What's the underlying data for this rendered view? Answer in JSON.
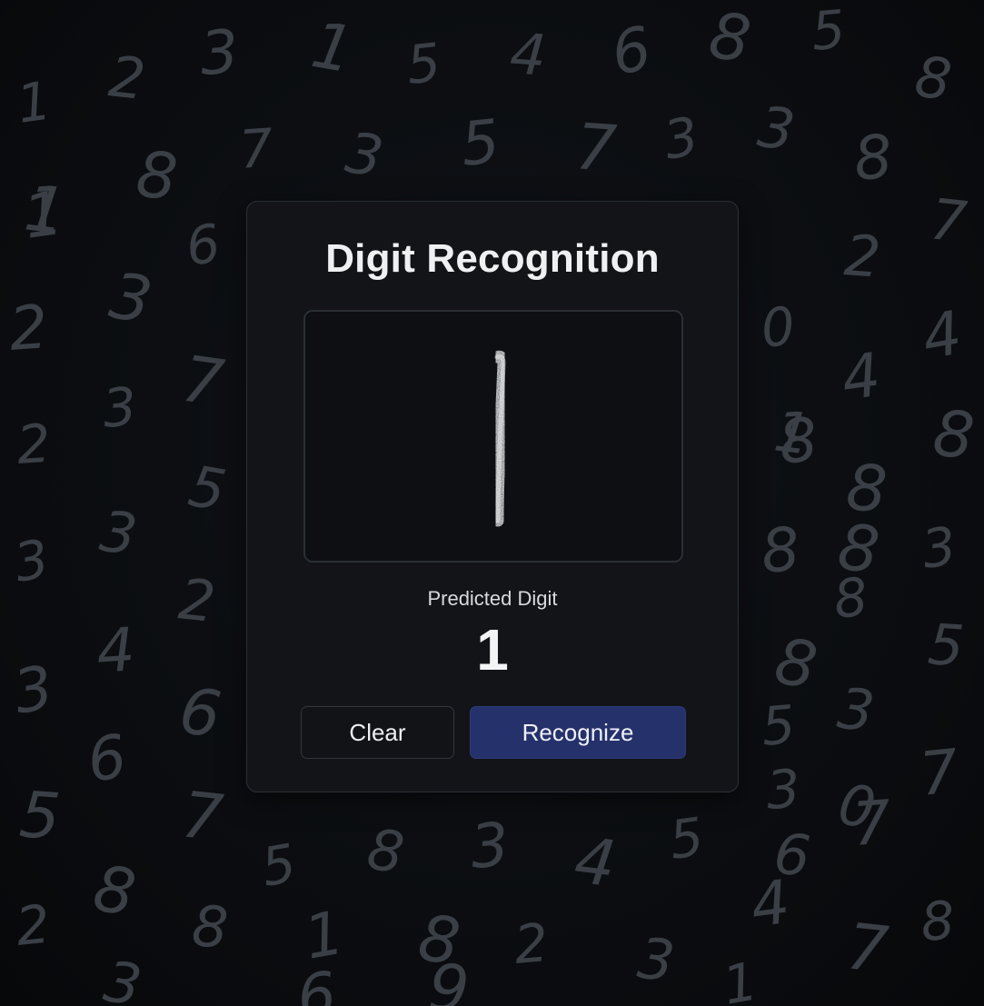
{
  "app": {
    "title": "Digit Recognition"
  },
  "canvas": {
    "drawn_digit": "1"
  },
  "prediction": {
    "label": "Predicted Digit",
    "value": "1"
  },
  "buttons": {
    "clear_label": "Clear",
    "recognize_label": "Recognize"
  },
  "colors": {
    "background": "#0b0d10",
    "card": "#121418",
    "primary_button": "#25316a",
    "handwriting": "#3a3f45"
  },
  "background_digits": "1 2 3 1 5 4 6 8 5 8 1 8 7 3 5 7 3 3 8 1 6 7 2 3 0 2 4 7 3 1 4 8 2 5 8 8 3 3 8 8 3 2 4 8 8 5 3 6 5 3 6 7 3 0 7 5 5 8 3 4 5 6 7 8 2 8 1 8 2 3 4 7 8 3 6 9 1"
}
